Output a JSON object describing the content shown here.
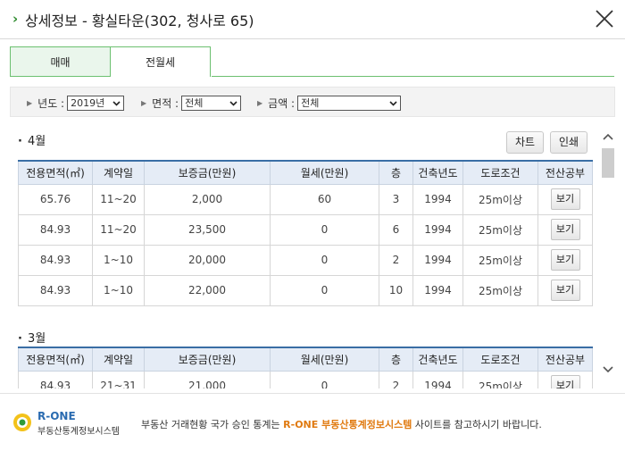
{
  "header": {
    "title": "상세정보 - 황실타운(302, 청사로 65)"
  },
  "tabs": [
    {
      "label": "매매"
    },
    {
      "label": "전월세"
    }
  ],
  "filters": {
    "year_label": "년도 :",
    "year_value": "2019년",
    "area_label": "면적 :",
    "area_value": "전체",
    "amount_label": "금액 :",
    "amount_value": "전체"
  },
  "buttons": {
    "chart": "차트",
    "print": "인쇄"
  },
  "columns": [
    "전용면적(㎡)",
    "계약일",
    "보증금(만원)",
    "월세(만원)",
    "층",
    "건축년도",
    "도로조건",
    "전산공부"
  ],
  "view_label": "보기",
  "sections": [
    {
      "month": "4월",
      "rows": [
        [
          "65.76",
          "11~20",
          "2,000",
          "60",
          "3",
          "1994",
          "25m이상"
        ],
        [
          "84.93",
          "11~20",
          "23,500",
          "0",
          "6",
          "1994",
          "25m이상"
        ],
        [
          "84.93",
          "1~10",
          "20,000",
          "0",
          "2",
          "1994",
          "25m이상"
        ],
        [
          "84.93",
          "1~10",
          "22,000",
          "0",
          "10",
          "1994",
          "25m이상"
        ]
      ]
    },
    {
      "month": "3월",
      "rows": [
        [
          "84.93",
          "21~31",
          "21,000",
          "0",
          "2",
          "1994",
          "25m이상"
        ]
      ]
    }
  ],
  "footer": {
    "brand": "R-ONE",
    "brand_sub": "부동산통계정보시스템",
    "notice_pre": "부동산 거래현황 국가 승인 통계는 ",
    "notice_hl": "R-ONE 부동산통계정보시스템",
    "notice_post": " 사이트를 참고하시기 바랍니다."
  },
  "colors": {
    "accent_green": "#6cc070",
    "table_header": "#e5ecf6",
    "highlight": "#e07a10"
  }
}
